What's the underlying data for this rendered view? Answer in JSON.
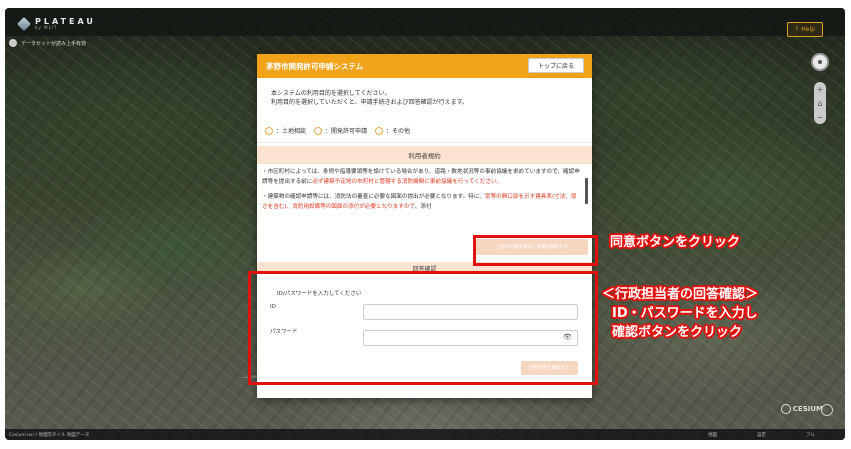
{
  "app": {
    "logo_text": "PLATEAU",
    "logo_sub": "by MLIT",
    "help_label": "Help",
    "breadcrumb": "データセットが読み上手有効"
  },
  "footer": {
    "left_text": "Cesium ion / 地理院タイル 地図データ",
    "right_items": [
      "地図",
      "設定",
      "フル"
    ]
  },
  "dialog": {
    "title": "茅野市開発許可申請システム",
    "top_button": "トップに戻る",
    "intro_line1": "本システムの利用目的を選択してください。",
    "intro_line2": "利用目的を選択していただくと、申請手続きおよび回答確認が行えます。",
    "options": [
      "：土地相談",
      "：開発許可申請",
      "：その他"
    ],
    "terms_header": "利用者規約",
    "terms_p1_a": "・市区町村によっては、条例や指導要領等を設けている場合があり、道路・数地状況等の事前協議を求めていますので、確認申請等を提出する前に",
    "terms_p1_red": "必ず建築予定地の市町村と管轄する消防機関に事前協議を行ってください。",
    "terms_p2_a": "・建築物の確認申請等には、消防法の審査に必要な図面の提出が必要となります。特に、",
    "terms_p2_red": "窓等の開口部を示す建具表(寸法、厚さを含む)、消防用設備等の図面の添付が必要となりますので",
    "terms_p2_b": "、添付",
    "agree_button": "上記の内容を確認し申請を開始する",
    "answer_header": "回答確認",
    "login_label": "ID/パスワードを入力してください",
    "id_label": "ID",
    "password_label": "パスワード",
    "id_value": "",
    "password_value": "",
    "confirm_button": "回答内容を確認する"
  },
  "annotations": {
    "callout1": "同意ボタンをクリック",
    "callout2_line1": "＜行政担当者の回答確認＞",
    "callout2_line2": "ID・パスワードを入力し",
    "callout2_line3": "確認ボタンをクリック",
    "highlight_color": "#e3110e"
  },
  "colors": {
    "accent": "#f3a31a",
    "section_bg": "#fbe4cf",
    "warning_text": "#e03a20"
  }
}
